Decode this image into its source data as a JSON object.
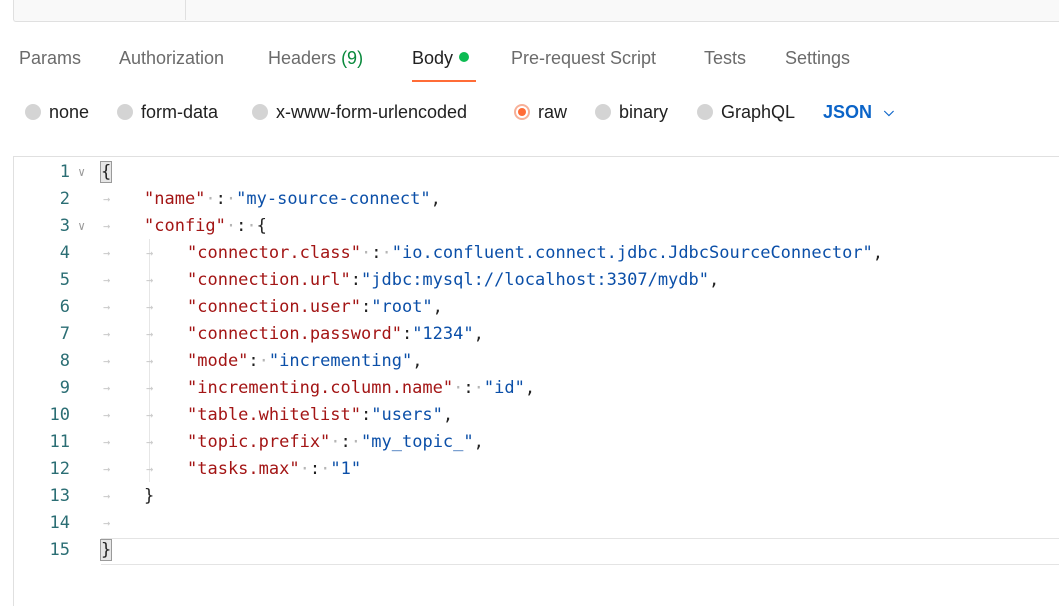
{
  "tabs": [
    {
      "label": "Params"
    },
    {
      "label": "Authorization"
    },
    {
      "label": "Headers",
      "count": "(9)"
    },
    {
      "label": "Body"
    },
    {
      "label": "Pre-request Script"
    },
    {
      "label": "Tests"
    },
    {
      "label": "Settings"
    }
  ],
  "active_tab": "Body",
  "body_types": [
    {
      "label": "none"
    },
    {
      "label": "form-data"
    },
    {
      "label": "x-www-form-urlencoded"
    },
    {
      "label": "raw"
    },
    {
      "label": "binary"
    },
    {
      "label": "GraphQL"
    }
  ],
  "selected_body_type": "raw",
  "format_select": {
    "label": "JSON",
    "icon": "chevron-down-icon"
  },
  "editor": {
    "line_numbers": [
      "1",
      "2",
      "3",
      "4",
      "5",
      "6",
      "7",
      "8",
      "9",
      "10",
      "11",
      "12",
      "13",
      "14",
      "15"
    ],
    "lines": [
      "{",
      "\"name\" : \"my-source-connect\",",
      "\"config\" : {",
      "\"connector.class\" : \"io.confluent.connect.jdbc.JdbcSourceConnector\",",
      "\"connection.url\":\"jdbc:mysql://localhost:3307/mydb\",",
      "\"connection.user\":\"root\",",
      "\"connection.password\":\"1234\",",
      "\"mode\": \"incrementing\",",
      "\"incrementing.column.name\" : \"id\",",
      "\"table.whitelist\":\"users\",",
      "\"topic.prefix\" : \"my_topic_\",",
      "\"tasks.max\" : \"1\"",
      "}",
      "",
      "}"
    ]
  },
  "colors": {
    "accent": "#ff6c37",
    "active_dot": "#0cbb52",
    "json_link": "#0b64c8",
    "string": "#0b4fa8",
    "key": "#a31515"
  }
}
